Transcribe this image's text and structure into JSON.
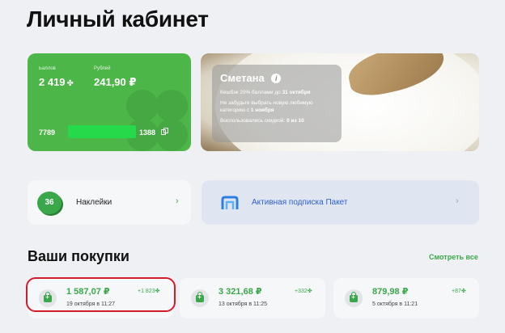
{
  "page_title": "Личный кабинет",
  "loyalty_card": {
    "points_label": "Баллов",
    "points_value": "2 419",
    "points_icon": "clover-icon",
    "rubles_label": "Рублей",
    "rubles_value": "241,90 ₽",
    "card_number_start": "7789",
    "card_number_end": "1388",
    "accent_color": "#4cb648"
  },
  "promo": {
    "title": "Сметана",
    "line1": "Кешбэк 20% баллами до",
    "line1_bold": "31 октября",
    "line2": "Не забудьте выбрать новую любимую категорию с",
    "line2_bold": "1 ноября",
    "line3": "Воспользовались скидкой:",
    "line3_bold": "0 из 10"
  },
  "stickers": {
    "count": "36",
    "label": "Наклейки"
  },
  "subscription": {
    "label": "Активная подписка Пакет"
  },
  "purchases": {
    "title": "Ваши покупки",
    "see_all": "Смотреть все",
    "items": [
      {
        "amount": "1 587,07 ₽",
        "bonus": "+1 823",
        "date": "19 октября в 11:27"
      },
      {
        "amount": "3 321,68 ₽",
        "bonus": "+332",
        "date": "13 октября в 11:25"
      },
      {
        "amount": "879,98 ₽",
        "bonus": "+87",
        "date": "5 октября в 11:21"
      }
    ]
  },
  "colors": {
    "brand_green": "#4cb648",
    "link_blue": "#2f5fd0",
    "highlight_red": "#d21c2c"
  }
}
